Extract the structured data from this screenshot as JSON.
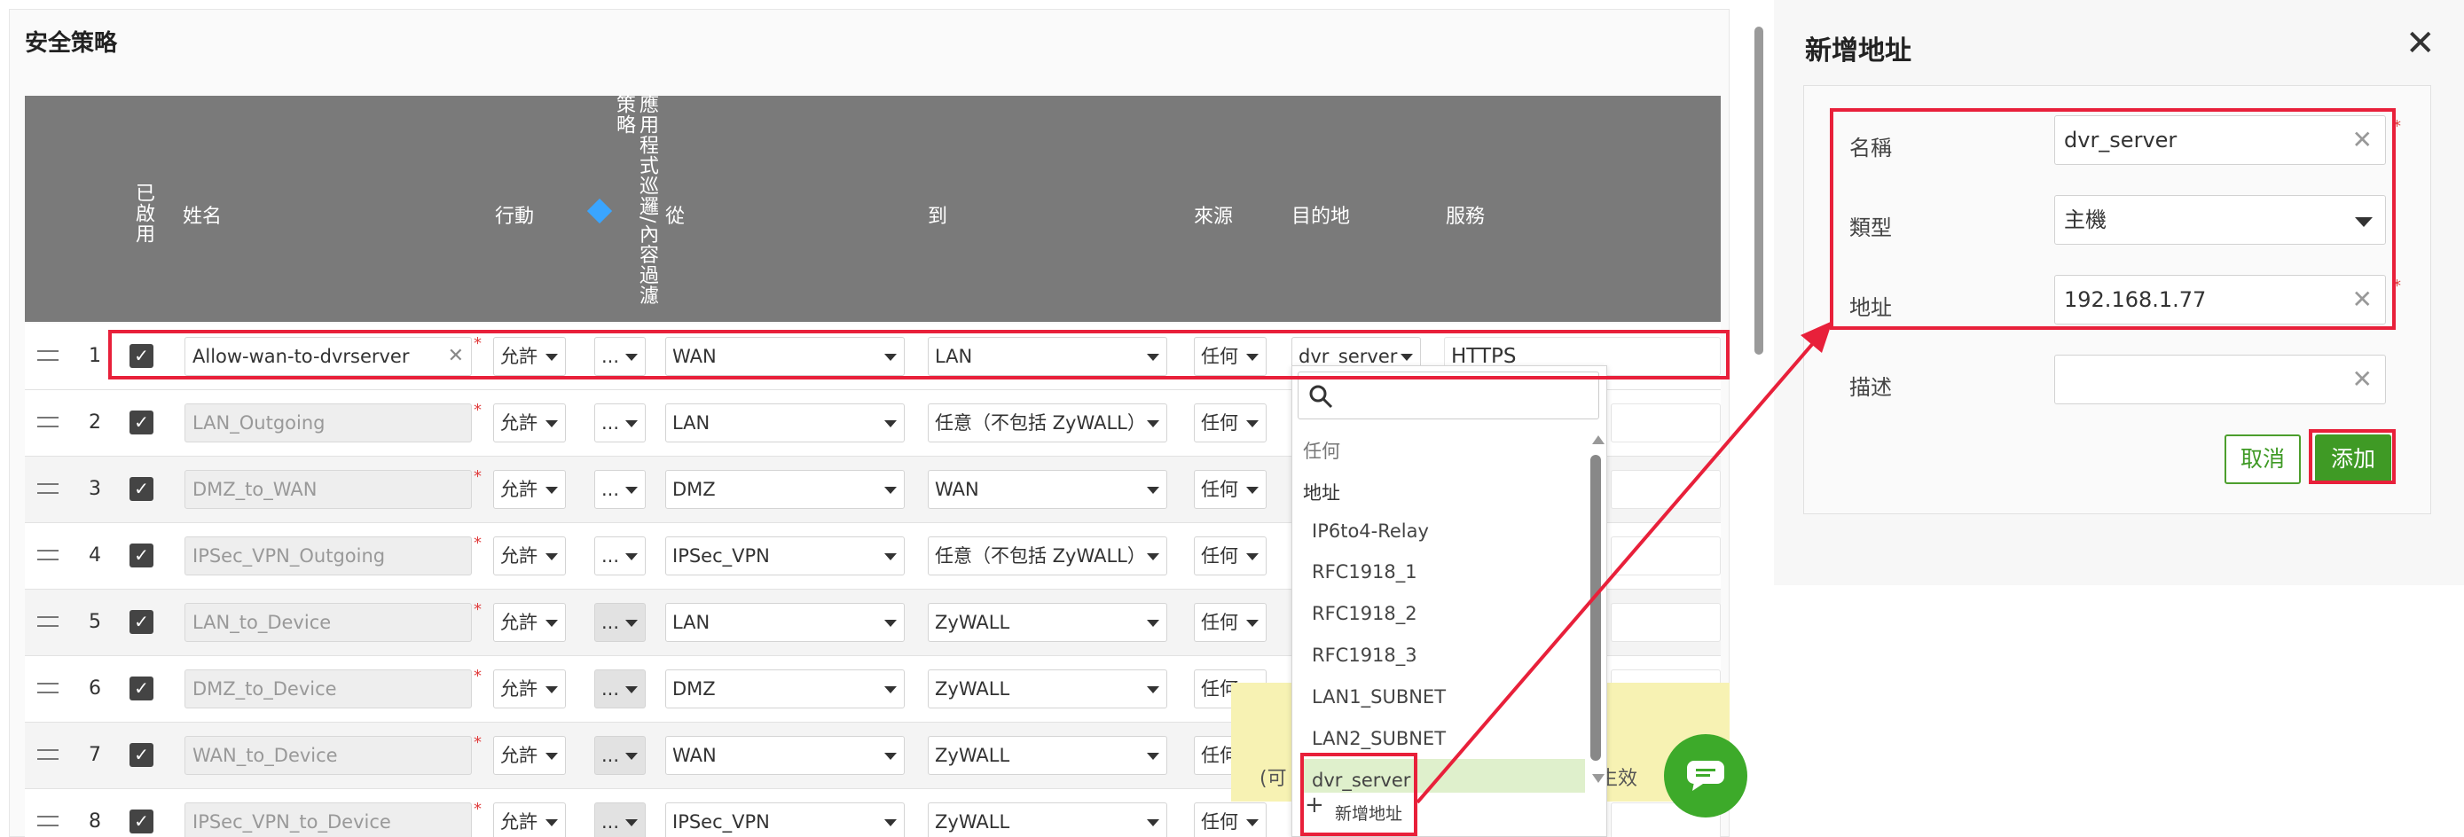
{
  "page_title": "安全策略",
  "table": {
    "headers": {
      "enabled": "已啟用",
      "name": "姓名",
      "action": "行動",
      "app_filter": "應用程式巡邏/內容過濾策略",
      "from": "從",
      "to": "到",
      "source": "來源",
      "destination": "目的地",
      "service": "服務"
    },
    "rows": [
      {
        "index": "1",
        "name": "Allow-wan-to-dvrserver",
        "action": "允許",
        "app": "...",
        "from": "WAN",
        "to": "LAN",
        "source": "任何",
        "destination": "dvr_server",
        "service": "HTTPS"
      },
      {
        "index": "2",
        "name": "LAN_Outgoing",
        "action": "允許",
        "app": "...",
        "from": "LAN",
        "to": "任意（不包括 ZyWALL）",
        "source": "任何"
      },
      {
        "index": "3",
        "name": "DMZ_to_WAN",
        "action": "允許",
        "app": "...",
        "from": "DMZ",
        "to": "WAN",
        "source": "任何"
      },
      {
        "index": "4",
        "name": "IPSec_VPN_Outgoing",
        "action": "允許",
        "app": "...",
        "from": "IPSec_VPN",
        "to": "任意（不包括 ZyWALL）",
        "source": "任何"
      },
      {
        "index": "5",
        "name": "LAN_to_Device",
        "action": "允許",
        "app": "...",
        "from": "LAN",
        "to": "ZyWALL",
        "source": "任何"
      },
      {
        "index": "6",
        "name": "DMZ_to_Device",
        "action": "允許",
        "app": "...",
        "from": "DMZ",
        "to": "ZyWALL",
        "source": "任何"
      },
      {
        "index": "7",
        "name": "WAN_to_Device",
        "action": "允許",
        "app": "...",
        "from": "WAN",
        "to": "ZyWALL",
        "source": "任何"
      },
      {
        "index": "8",
        "name": "IPSec_VPN_to_Device",
        "action": "允許",
        "app": "...",
        "from": "IPSec_VPN",
        "to": "ZyWALL",
        "source": "任何"
      }
    ]
  },
  "dropdown": {
    "items": [
      {
        "label": "任何",
        "kind": "muted"
      },
      {
        "label": "地址",
        "kind": "group"
      },
      {
        "label": "IP6to4-Relay",
        "kind": "item"
      },
      {
        "label": "RFC1918_1",
        "kind": "item"
      },
      {
        "label": "RFC1918_2",
        "kind": "item"
      },
      {
        "label": "RFC1918_3",
        "kind": "item"
      },
      {
        "label": "LAN1_SUBNET",
        "kind": "item"
      },
      {
        "label": "LAN2_SUBNET",
        "kind": "item"
      },
      {
        "label": "dvr_server",
        "kind": "selected"
      }
    ],
    "add_new": "新增地址"
  },
  "banner": {
    "left_text": "(可",
    "right_text": "會生效"
  },
  "panel": {
    "title": "新增地址",
    "fields": [
      {
        "label": "名稱",
        "value": "dvr_server"
      },
      {
        "label": "類型",
        "value": "主機"
      },
      {
        "label": "地址",
        "value": "192.168.1.77"
      },
      {
        "label": "描述",
        "value": ""
      }
    ],
    "cancel": "取消",
    "add": "添加"
  },
  "colors": {
    "accent": "#e8203a",
    "green": "#3f9a25",
    "header": "#7a7a7a"
  }
}
